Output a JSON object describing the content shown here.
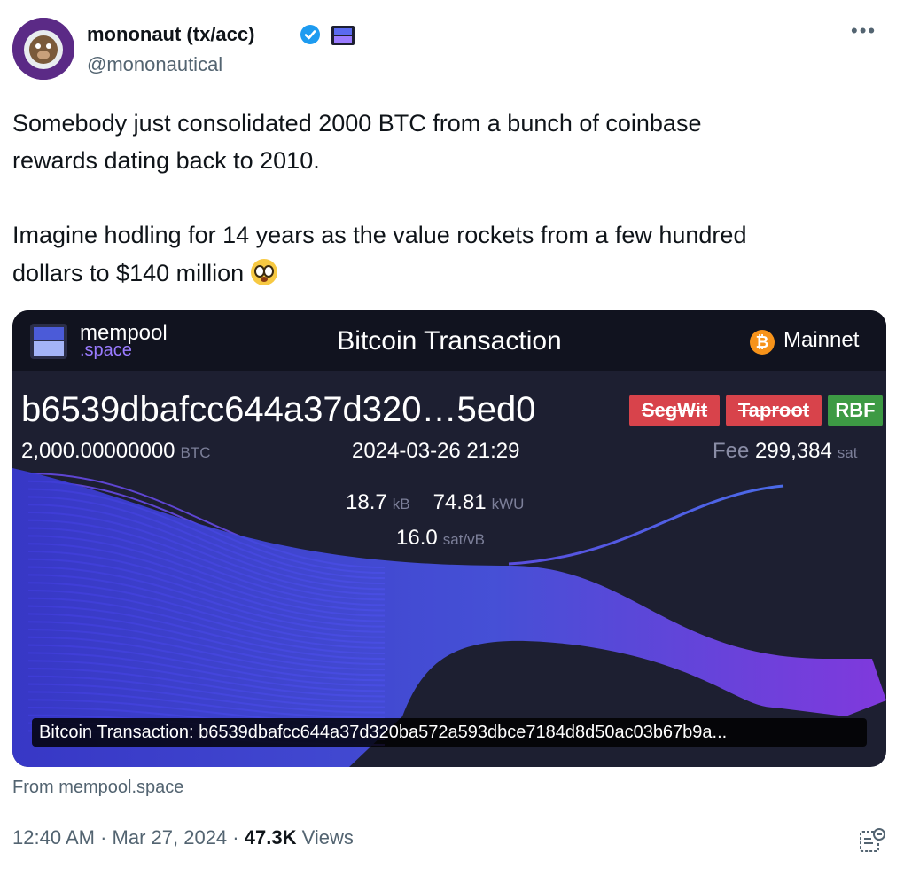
{
  "author": {
    "display_name": "mononaut (tx/acc)",
    "handle": "@mononautical",
    "avatar_icon": "astronaut-monkey-avatar",
    "verified_icon": "verified-badge-icon",
    "affiliate_icon": "mempool-logo-icon"
  },
  "tweet": {
    "line1": "Somebody just consolidated 2000 BTC from a bunch of coinbase",
    "line2": "rewards dating back to 2010.",
    "line3": "Imagine hodling for 14 years as the value rockets from a few hundred",
    "line4": "dollars to $140 million",
    "emoji": "flushed-face-emoji"
  },
  "card": {
    "logo_line1": "mempool",
    "logo_line2": ".space",
    "title": "Bitcoin Transaction",
    "network": "Mainnet",
    "network_icon": "₿",
    "txid_short": "b6539dbafcc644a37d320…5ed0",
    "badges": {
      "segwit": "SegWit",
      "taproot": "Taproot",
      "rbf": "RBF"
    },
    "amount": "2,000.00000000",
    "amount_unit": "BTC",
    "datetime": "2024-03-26 21:29",
    "fee_label": "Fee",
    "fee_value": "299,384",
    "fee_unit": "sat",
    "size": "18.7",
    "size_unit": "kB",
    "weight": "74.81",
    "weight_unit": "kWU",
    "feerate": "16.0",
    "feerate_unit": "sat/vB",
    "caption": "Bitcoin Transaction: b6539dbafcc644a37d320ba572a593dbce7184d8d50ac03b67b9a...",
    "colors": {
      "flow_start": "#3a3ad6",
      "flow_mid": "#4a55e8",
      "flow_end": "#8b3cf0",
      "bg": "#1d1f31"
    }
  },
  "footer": {
    "source": "From mempool.space",
    "time": "12:40 AM",
    "separator": "·",
    "date": "Mar 27, 2024",
    "views_count": "47.3K",
    "views_label": "Views"
  }
}
